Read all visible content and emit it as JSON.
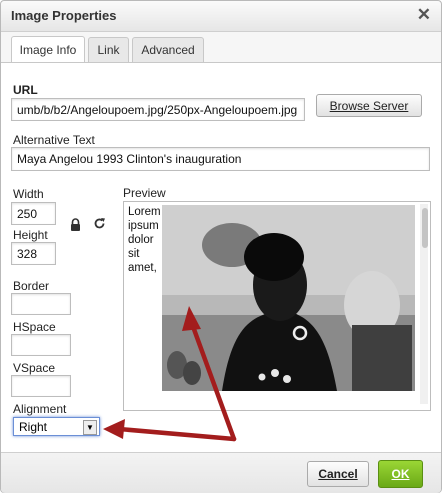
{
  "dialog": {
    "title": "Image Properties",
    "close_icon": "close-icon"
  },
  "tabs": [
    {
      "label": "Image Info",
      "active": true
    },
    {
      "label": "Link",
      "active": false
    },
    {
      "label": "Advanced",
      "active": false
    }
  ],
  "form": {
    "url_label": "URL",
    "url_value": "umb/b/b2/Angeloupoem.jpg/250px-Angeloupoem.jpg",
    "browse_label": "Browse Server",
    "alt_label": "Alternative Text",
    "alt_value": "Maya Angelou 1993 Clinton's inauguration",
    "width_label": "Width",
    "width_value": "250",
    "height_label": "Height",
    "height_value": "328",
    "border_label": "Border",
    "hspace_label": "HSpace",
    "vspace_label": "VSpace",
    "alignment_label": "Alignment",
    "alignment_value": "Right",
    "lock_icon": "lock-icon",
    "reset_icon": "reset-size-icon"
  },
  "preview": {
    "label": "Preview",
    "text": "Lorem ipsum dolor sit amet,"
  },
  "footer": {
    "cancel_label": "Cancel",
    "ok_label": "OK"
  },
  "colors": {
    "ok_green": "#7fbf1f",
    "annotation_arrow": "#a31d1d",
    "focus_blue": "#6b8fd6"
  }
}
